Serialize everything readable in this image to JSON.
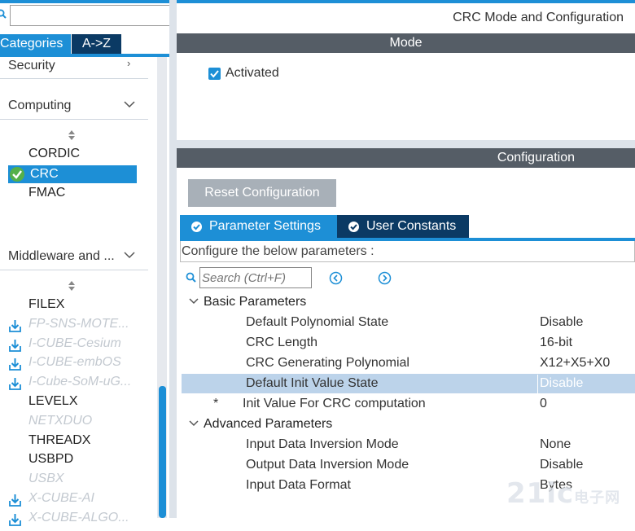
{
  "left_panel": {
    "search": {
      "value": "",
      "placeholder": ""
    },
    "tabs": {
      "categories": "Categories",
      "az": "A->Z"
    },
    "categories": {
      "security": "Security",
      "computing": "Computing",
      "middleware": "Middleware and ..."
    },
    "computing_items": [
      "CORDIC",
      "CRC",
      "FMAC"
    ],
    "selected_item": "CRC",
    "middleware_items": [
      {
        "label": "FILEX",
        "disabled": false,
        "download": false
      },
      {
        "label": "FP-SNS-MOTE...",
        "disabled": true,
        "download": true
      },
      {
        "label": "I-CUBE-Cesium",
        "disabled": true,
        "download": true
      },
      {
        "label": "I-CUBE-embOS",
        "disabled": true,
        "download": true
      },
      {
        "label": "I-Cube-SoM-uG...",
        "disabled": true,
        "download": true
      },
      {
        "label": "LEVELX",
        "disabled": false,
        "download": false
      },
      {
        "label": "NETXDUO",
        "disabled": true,
        "download": false
      },
      {
        "label": "THREADX",
        "disabled": false,
        "download": false
      },
      {
        "label": "USBPD",
        "disabled": false,
        "download": false
      },
      {
        "label": "USBX",
        "disabled": true,
        "download": false
      },
      {
        "label": "X-CUBE-AI",
        "disabled": true,
        "download": true
      },
      {
        "label": "X-CUBE-ALGO...",
        "disabled": true,
        "download": true
      }
    ]
  },
  "main": {
    "title": "CRC Mode and Configuration",
    "mode_header": "Mode",
    "activated_label": "Activated",
    "activated_checked": true,
    "config_header": "Configuration",
    "reset_button": "Reset Configuration",
    "tabs": {
      "parameter_settings": "Parameter Settings",
      "user_constants": "User Constants"
    },
    "configure_hint": "Configure the below parameters :",
    "search_placeholder": "Search (Ctrl+F)",
    "groups": {
      "basic": "Basic Parameters",
      "advanced": "Advanced Parameters"
    },
    "basic_params": [
      {
        "name": "Default Polynomial State",
        "value": "Disable"
      },
      {
        "name": "CRC Length",
        "value": "16-bit"
      },
      {
        "name": "CRC Generating Polynomial",
        "value": "X12+X5+X0"
      },
      {
        "name": "Default Init Value State",
        "value": "Disable"
      },
      {
        "name": "Init Value For CRC computation",
        "value": "0",
        "required": "*"
      }
    ],
    "advanced_params": [
      {
        "name": "Input Data Inversion Mode",
        "value": "None"
      },
      {
        "name": "Output Data Inversion Mode",
        "value": "Disable"
      },
      {
        "name": "Input Data Format",
        "value": "Bytes"
      }
    ]
  },
  "watermark": {
    "text": "21ic",
    "sub": "电子网"
  },
  "colors": {
    "accent": "#1d8fd6",
    "dark_tab": "#0b3a64",
    "header_bar": "#555d66",
    "selected_row": "#bcd3ea"
  }
}
